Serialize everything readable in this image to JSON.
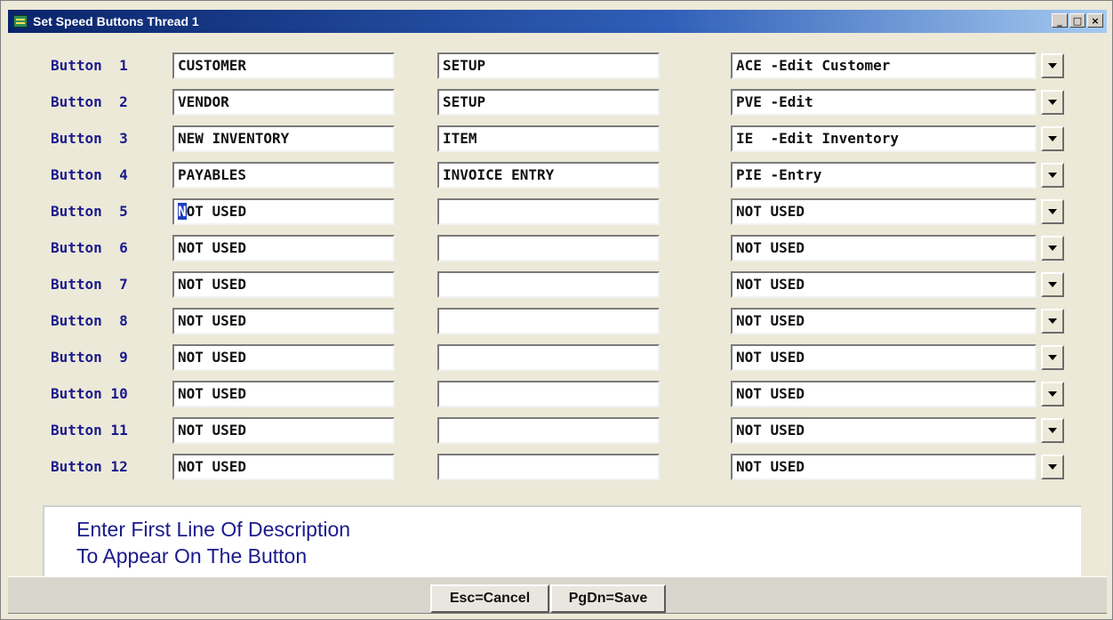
{
  "window": {
    "title": "Set Speed Buttons Thread 1",
    "controls": {
      "minimize": "_",
      "maximize": "□",
      "close": "×"
    }
  },
  "rows": [
    {
      "label": "Button  1",
      "line1": "CUSTOMER",
      "line2": "SETUP",
      "command": "ACE -Edit Customer"
    },
    {
      "label": "Button  2",
      "line1": "VENDOR",
      "line2": "SETUP",
      "command": "PVE -Edit"
    },
    {
      "label": "Button  3",
      "line1": "NEW INVENTORY",
      "line2": "ITEM",
      "command": "IE  -Edit Inventory"
    },
    {
      "label": "Button  4",
      "line1": "PAYABLES",
      "line2": "INVOICE ENTRY",
      "command": "PIE -Entry"
    },
    {
      "label": "Button  5",
      "line1_cursor": "N",
      "line1_rest": "OT USED",
      "line2": "",
      "command": "NOT USED"
    },
    {
      "label": "Button  6",
      "line1": "NOT USED",
      "line2": "",
      "command": "NOT USED"
    },
    {
      "label": "Button  7",
      "line1": "NOT USED",
      "line2": "",
      "command": "NOT USED"
    },
    {
      "label": "Button  8",
      "line1": "NOT USED",
      "line2": "",
      "command": "NOT USED"
    },
    {
      "label": "Button  9",
      "line1": "NOT USED",
      "line2": "",
      "command": "NOT USED"
    },
    {
      "label": "Button 10",
      "line1": "NOT USED",
      "line2": "",
      "command": "NOT USED"
    },
    {
      "label": "Button 11",
      "line1": "NOT USED",
      "line2": "",
      "command": "NOT USED"
    },
    {
      "label": "Button 12",
      "line1": "NOT USED",
      "line2": "",
      "command": "NOT USED"
    }
  ],
  "help": {
    "line1": "Enter First Line Of Description",
    "line2": "To Appear On The Button"
  },
  "actions": {
    "cancel_label": "Esc=Cancel",
    "save_label": "PgDn=Save"
  },
  "colors": {
    "label_text": "#1a1a8c",
    "title_bar": "#0a246a",
    "cursor_highlight": "#1f3fbf"
  }
}
